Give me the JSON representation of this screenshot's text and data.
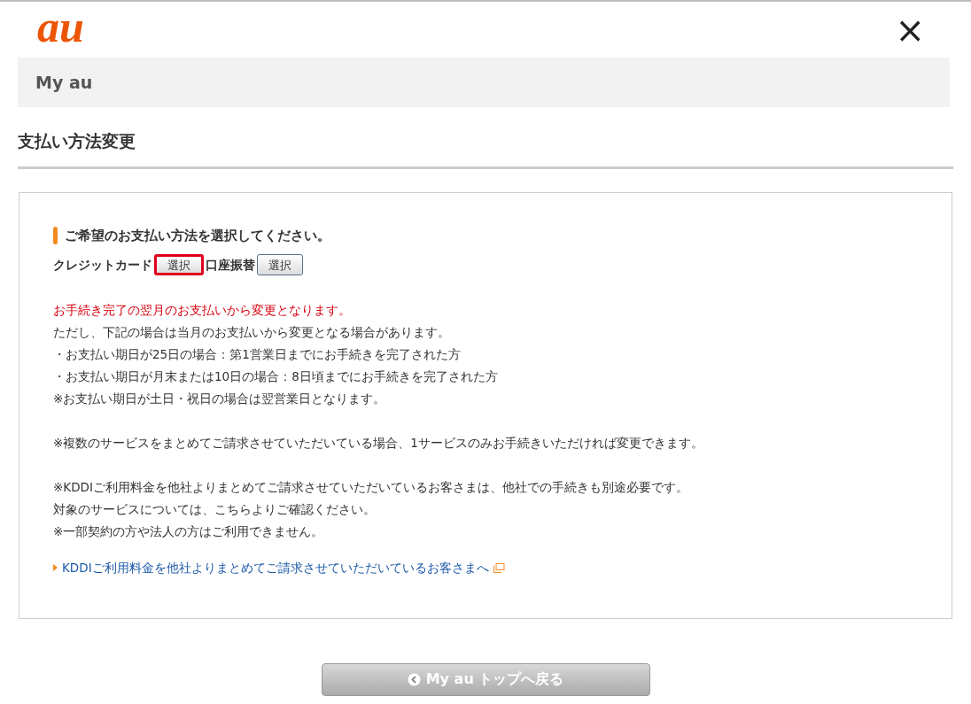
{
  "header": {
    "logo": "au",
    "close": "×"
  },
  "breadcrumb": "My au",
  "page_title": "支払い方法変更",
  "panel": {
    "heading": "ご希望のお支払い方法を選択してください。",
    "options": [
      {
        "label": "クレジットカード",
        "button": "選択",
        "highlighted": true
      },
      {
        "label": "口座振替",
        "button": "選択",
        "highlighted": false
      }
    ],
    "notes": [
      {
        "lines": [
          {
            "text": "お手続き完了の翌月のお支払いから変更となります。",
            "kind": "warning"
          },
          {
            "text": "ただし、下記の場合は当月のお支払いから変更となる場合があります。",
            "kind": "plain"
          },
          {
            "text": "・お支払い期日が25日の場合：第1営業日までにお手続きを完了された方",
            "kind": "plain"
          },
          {
            "text": "・お支払い期日が月末または10日の場合：8日頃までにお手続きを完了された方",
            "kind": "plain"
          },
          {
            "text": "※お支払い期日が土日・祝日の場合は翌営業日となります。",
            "kind": "plain"
          }
        ]
      },
      {
        "lines": [
          {
            "text": "※複数のサービスをまとめてご請求させていただいている場合、1サービスのみお手続きいただければ変更できます。",
            "kind": "plain"
          }
        ]
      },
      {
        "lines": [
          {
            "text": "※KDDIご利用料金を他社よりまとめてご請求させていただいているお客さまは、他社での手続きも別途必要です。",
            "kind": "plain"
          },
          {
            "text": "対象のサービスについては、こちらよりご確認ください。",
            "kind": "plain"
          },
          {
            "text": "※一部契約の方や法人の方はご利用できません。",
            "kind": "plain"
          }
        ]
      }
    ],
    "link": "KDDIご利用料金を他社よりまとめてご請求させていただいているお客さまへ"
  },
  "back_button": "My au トップへ戻る"
}
